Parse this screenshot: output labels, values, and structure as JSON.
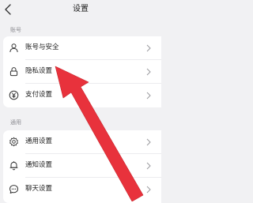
{
  "header": {
    "title": "设置",
    "back_icon": "chevron-left-icon"
  },
  "sections": [
    {
      "label": "账号",
      "items": [
        {
          "label": "账号与安全",
          "icon": "user-icon"
        },
        {
          "label": "隐私设置",
          "icon": "lock-icon"
        },
        {
          "label": "支付设置",
          "icon": "yen-icon"
        }
      ]
    },
    {
      "label": "通用",
      "items": [
        {
          "label": "通用设置",
          "icon": "gear-icon"
        },
        {
          "label": "通知设置",
          "icon": "bell-icon"
        },
        {
          "label": "聊天设置",
          "icon": "chat-icon"
        }
      ]
    }
  ],
  "annotation": {
    "arrow_color": "#e8323c",
    "arrow_target": "隐私设置"
  }
}
